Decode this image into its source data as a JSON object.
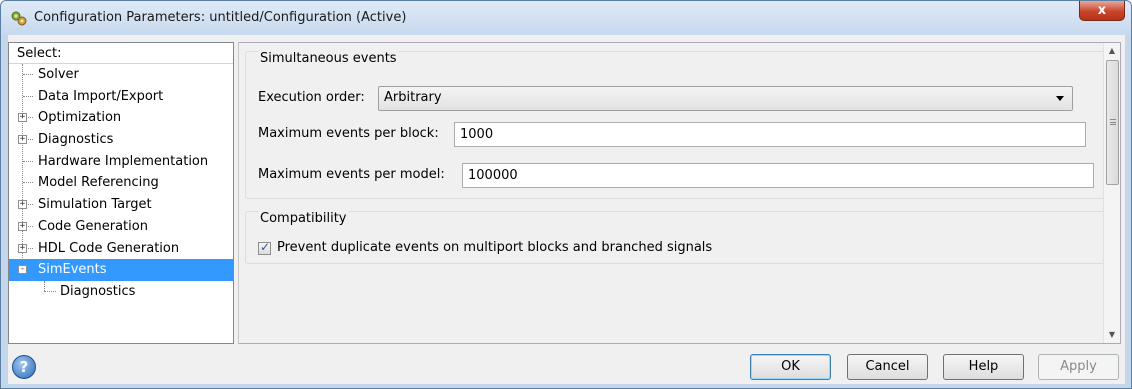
{
  "window": {
    "title": "Configuration Parameters: untitled/Configuration (Active)",
    "close_symbol": "x"
  },
  "tree": {
    "header": "Select:",
    "items": [
      {
        "label": "Solver",
        "expandable": false
      },
      {
        "label": "Data Import/Export",
        "expandable": false
      },
      {
        "label": "Optimization",
        "expandable": true
      },
      {
        "label": "Diagnostics",
        "expandable": true
      },
      {
        "label": "Hardware Implementation",
        "expandable": false
      },
      {
        "label": "Model Referencing",
        "expandable": false
      },
      {
        "label": "Simulation Target",
        "expandable": true
      },
      {
        "label": "Code Generation",
        "expandable": true
      },
      {
        "label": "HDL Code Generation",
        "expandable": true
      },
      {
        "label": "SimEvents",
        "expandable": true,
        "expanded": true,
        "selected": true
      },
      {
        "label": "Diagnostics",
        "child": true
      }
    ],
    "expander_plus": "+",
    "expander_minus": "-"
  },
  "simultaneous": {
    "title": "Simultaneous events",
    "execution_order_label": "Execution order:",
    "execution_order_value": "Arbitrary",
    "max_per_block_label": "Maximum events per block:",
    "max_per_block_value": "1000",
    "max_per_model_label": "Maximum events per model:",
    "max_per_model_value": "100000"
  },
  "compatibility": {
    "title": "Compatibility",
    "prevent_duplicate_label": "Prevent duplicate events on multiport blocks and branched signals",
    "prevent_duplicate_checked": true,
    "check_glyph": "✓"
  },
  "buttons": {
    "ok": "OK",
    "cancel": "Cancel",
    "help": "Help",
    "apply": "Apply"
  },
  "help_icon_glyph": "?",
  "scroll": {
    "up": "▲",
    "down": "▼"
  },
  "colors": {
    "selection": "#3399ff",
    "titlebar": "#c7d9ee",
    "close_button": "#c8452c"
  }
}
